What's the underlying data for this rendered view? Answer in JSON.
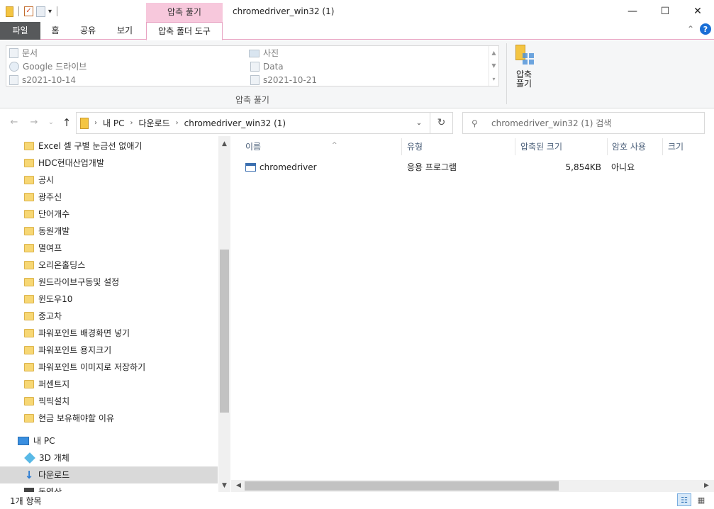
{
  "window": {
    "title": "chromedriver_win32 (1)",
    "context_tab_header": "압축 풀기",
    "minimize": "—",
    "maximize": "☐",
    "close": "✕"
  },
  "ribbon": {
    "tabs": {
      "file": "파일",
      "home": "홈",
      "share": "공유",
      "view": "보기",
      "context": "압축 폴더 도구"
    },
    "collapse": "⌃",
    "help": "?",
    "gallery": {
      "left": [
        "문서",
        "Google 드라이브",
        "s2021-10-14"
      ],
      "right": [
        "사진",
        "Data",
        "s2021-10-21"
      ]
    },
    "group_label": "압축 풀기",
    "extract_all_line1": "압축",
    "extract_all_line2": "풀기"
  },
  "address": {
    "back": "←",
    "forward": "→",
    "recent": "⌄",
    "up": "↑",
    "crumbs": [
      "내 PC",
      "다운로드",
      "chromedriver_win32 (1)"
    ],
    "sep": "›",
    "dropdown": "⌄",
    "refresh": "↻"
  },
  "search": {
    "icon": "⚲",
    "placeholder": "chromedriver_win32 (1) 검색"
  },
  "nav": {
    "folders": [
      "Excel 셀 구별 눈금선 없애기",
      "HDC현대산업개발",
      "공시",
      "광주신",
      "단어개수",
      "동원개발",
      "멸여프",
      "오리온홀딩스",
      "원드라이브구동및 설정",
      "윈도우10",
      "중고차",
      "파워포인트 배경화면 넣기",
      "파워포인트 용지크기",
      "파워포인트 이미지로 저장하기",
      "퍼센트지",
      "픽픽설치",
      "현금 보유해야할 이유"
    ],
    "this_pc": "내 PC",
    "objects3d": "3D 개체",
    "downloads": "다운로드",
    "videos": "동영상",
    "scroll_up": "▲",
    "scroll_down": "▼"
  },
  "columns": {
    "name": "이름",
    "type": "유형",
    "compressed": "압축된 크기",
    "password": "암호 사용",
    "size": "크기",
    "sort_indicator": "^"
  },
  "files": [
    {
      "name": "chromedriver",
      "type": "응용 프로그램",
      "compressed": "5,854KB",
      "password": "아니요"
    }
  ],
  "hscroll": {
    "left": "◀",
    "right": "▶"
  },
  "status": {
    "count": "1개 항목",
    "details_view": "☷",
    "large_icons": "▦"
  },
  "colors": {
    "context_tab": "#f7c8dc",
    "file_tab": "#57595b",
    "accent": "#1a6fd6"
  }
}
